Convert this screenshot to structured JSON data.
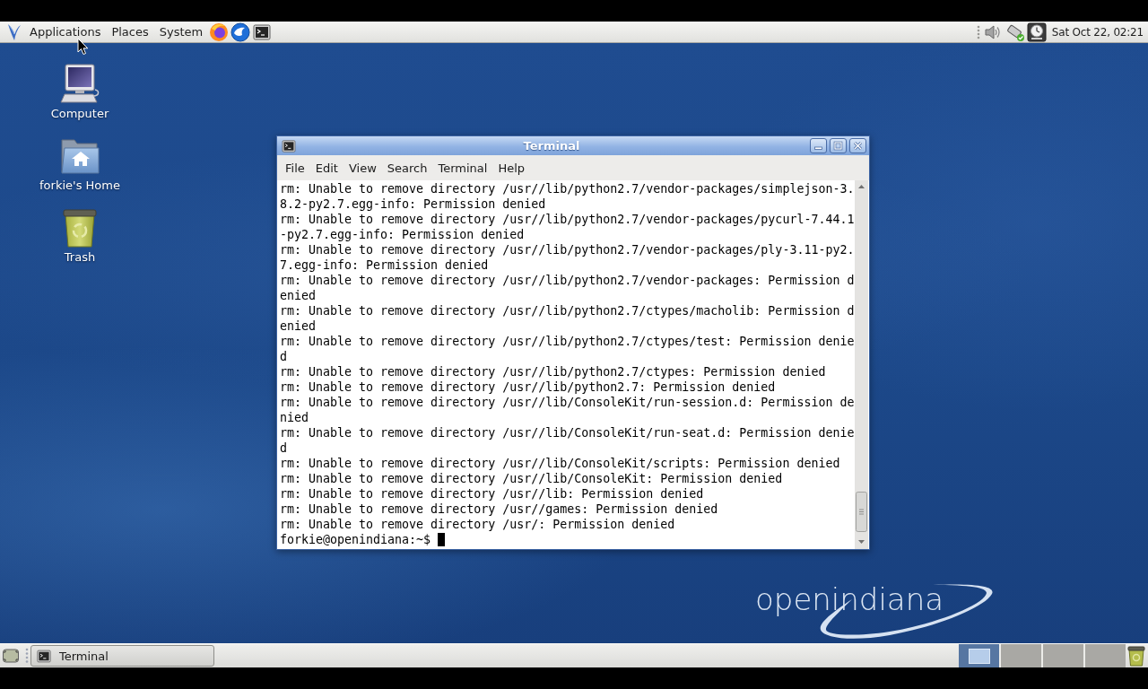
{
  "top_panel": {
    "menus": [
      "Applications",
      "Places",
      "System"
    ],
    "clock": "Sat Oct 22, 02:21"
  },
  "desktop_icons": [
    {
      "kind": "computer",
      "label": "Computer"
    },
    {
      "kind": "home",
      "label": "forkie's Home"
    },
    {
      "kind": "trash",
      "label": "Trash"
    }
  ],
  "terminal_window": {
    "title": "Terminal",
    "menu": [
      "File",
      "Edit",
      "View",
      "Search",
      "Terminal",
      "Help"
    ],
    "output": [
      "rm: Unable to remove directory /usr//lib/python2.7/vendor-packages/simplejson-3.8.2-py2.7.egg-info: Permission denied",
      "rm: Unable to remove directory /usr//lib/python2.7/vendor-packages/pycurl-7.44.1-py2.7.egg-info: Permission denied",
      "rm: Unable to remove directory /usr//lib/python2.7/vendor-packages/ply-3.11-py2.7.egg-info: Permission denied",
      "rm: Unable to remove directory /usr//lib/python2.7/vendor-packages: Permission denied",
      "rm: Unable to remove directory /usr//lib/python2.7/ctypes/macholib: Permission denied",
      "rm: Unable to remove directory /usr//lib/python2.7/ctypes/test: Permission denied",
      "rm: Unable to remove directory /usr//lib/python2.7/ctypes: Permission denied",
      "rm: Unable to remove directory /usr//lib/python2.7: Permission denied",
      "rm: Unable to remove directory /usr//lib/ConsoleKit/run-session.d: Permission denied",
      "rm: Unable to remove directory /usr//lib/ConsoleKit/run-seat.d: Permission denied",
      "rm: Unable to remove directory /usr//lib/ConsoleKit/scripts: Permission denied",
      "rm: Unable to remove directory /usr//lib/ConsoleKit: Permission denied",
      "rm: Unable to remove directory /usr//lib: Permission denied",
      "rm: Unable to remove directory /usr//games: Permission denied",
      "rm: Unable to remove directory /usr/: Permission denied"
    ],
    "prompt": "forkie@openindiana:~$",
    "cursor_visible": true
  },
  "bottom_panel": {
    "tasks": [
      {
        "label": "Terminal"
      }
    ],
    "workspaces": [
      {
        "selected": true,
        "has_window": true
      },
      {
        "selected": false,
        "has_window": false
      },
      {
        "selected": false,
        "has_window": false
      },
      {
        "selected": false,
        "has_window": false
      }
    ]
  },
  "wallpaper": {
    "logo_text": "openindiana"
  }
}
